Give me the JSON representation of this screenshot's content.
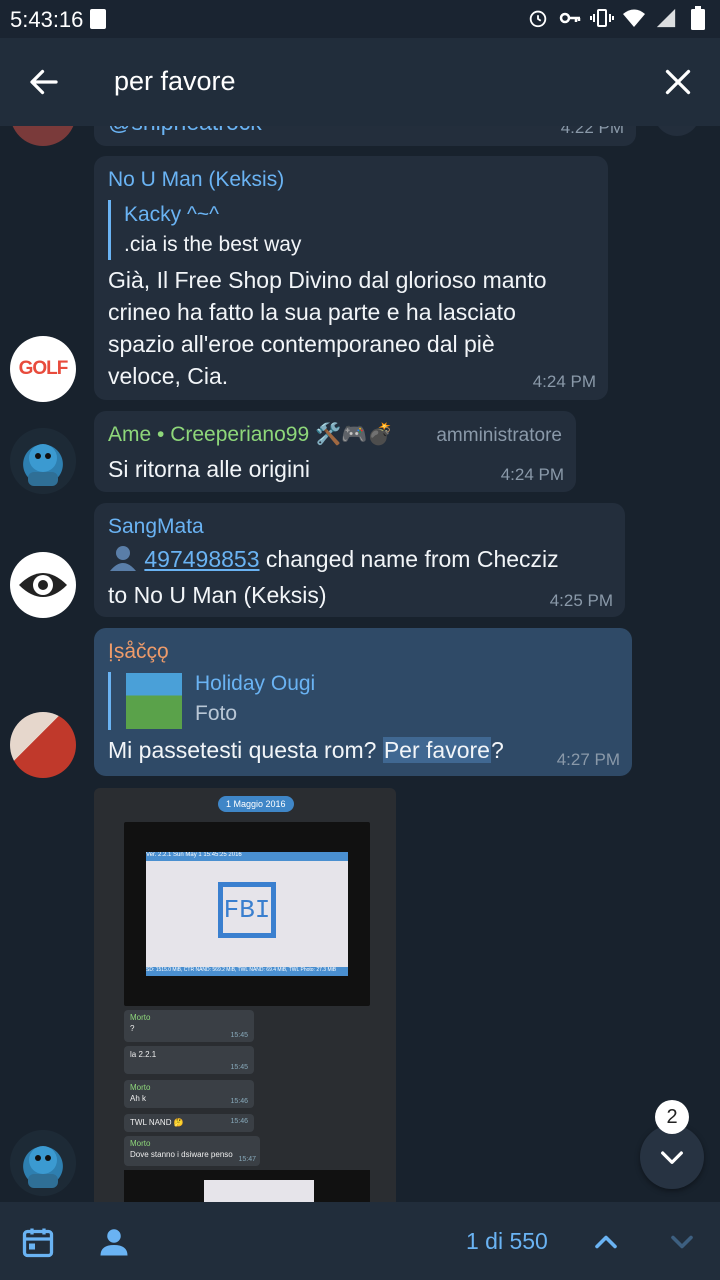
{
  "status_bar": {
    "time": "5:43:16"
  },
  "search": {
    "query": "per favore"
  },
  "partial_top": {
    "text": "@shipheatrock",
    "time": "4:22 PM"
  },
  "messages": [
    {
      "sender": "No U Man (Keksis)",
      "sender_color": "#6ab3f3",
      "avatar_text": "GOLF",
      "reply_name": "Kacky ^~^",
      "reply_text": ".cia is the best way",
      "text_lines": [
        "Già, Il Free Shop Divino dal glorioso manto",
        "crineo ha fatto la sua parte e ha lasciato",
        "spazio all'eroe contemporaneo dal piè",
        "veloce, Cia."
      ],
      "time": "4:24 PM"
    },
    {
      "sender": "Ame • Creeperiano99 🛠️🎮💣",
      "sender_color": "#8ed77a",
      "role": "amministratore",
      "text": "Si ritorna alle origini",
      "time": "4:24 PM"
    },
    {
      "sender": "SangMata",
      "sender_color": "#6ab3f3",
      "link_id": "497498853",
      "text_a": " changed name from Checziz",
      "text_b": "to No U Man (Keksis)",
      "time": "4:25 PM"
    },
    {
      "sender": "Ịṣåčçǫ",
      "sender_color": "#ee9b6a",
      "reply_name": "Holiday Ougi",
      "reply_text": "Foto",
      "text_pre": "Mi passetesti questa rom? ",
      "text_highlight": "Per favore",
      "text_post": "?",
      "time": "4:27 PM"
    }
  ],
  "photo": {
    "date_label": "1 Maggio 2016",
    "screen_text": "FBI",
    "screen_header": "Ver. 2.2.1      Sun May  1 15:45:25 2016",
    "screen_footer": "SD: 1515.0 MiB, CTR NAND: 569.2 MiB, TWL NAND: 69.4 MiB, TWL Photo: 27.3 MiB",
    "chat": [
      {
        "name": "Morto",
        "text": "?",
        "time": "15:45"
      },
      {
        "name": "",
        "text": "la 2.2.1",
        "time": "15:45"
      },
      {
        "name": "Morto",
        "text": "Ah k",
        "time": "15:46"
      },
      {
        "name": "",
        "text": "TWL NAND 🤔",
        "time": "15:46"
      },
      {
        "name": "Morto",
        "text": "Dove stanno i dsiware penso",
        "time": "15:47"
      }
    ]
  },
  "scroll_fab": {
    "badge": "2"
  },
  "bottom": {
    "counter": "1 di 550"
  },
  "colors": {
    "accent": "#6ab3f3",
    "highlight": "#406892",
    "bubble": "#232e3c",
    "bubble_selected": "#2f4a67"
  }
}
